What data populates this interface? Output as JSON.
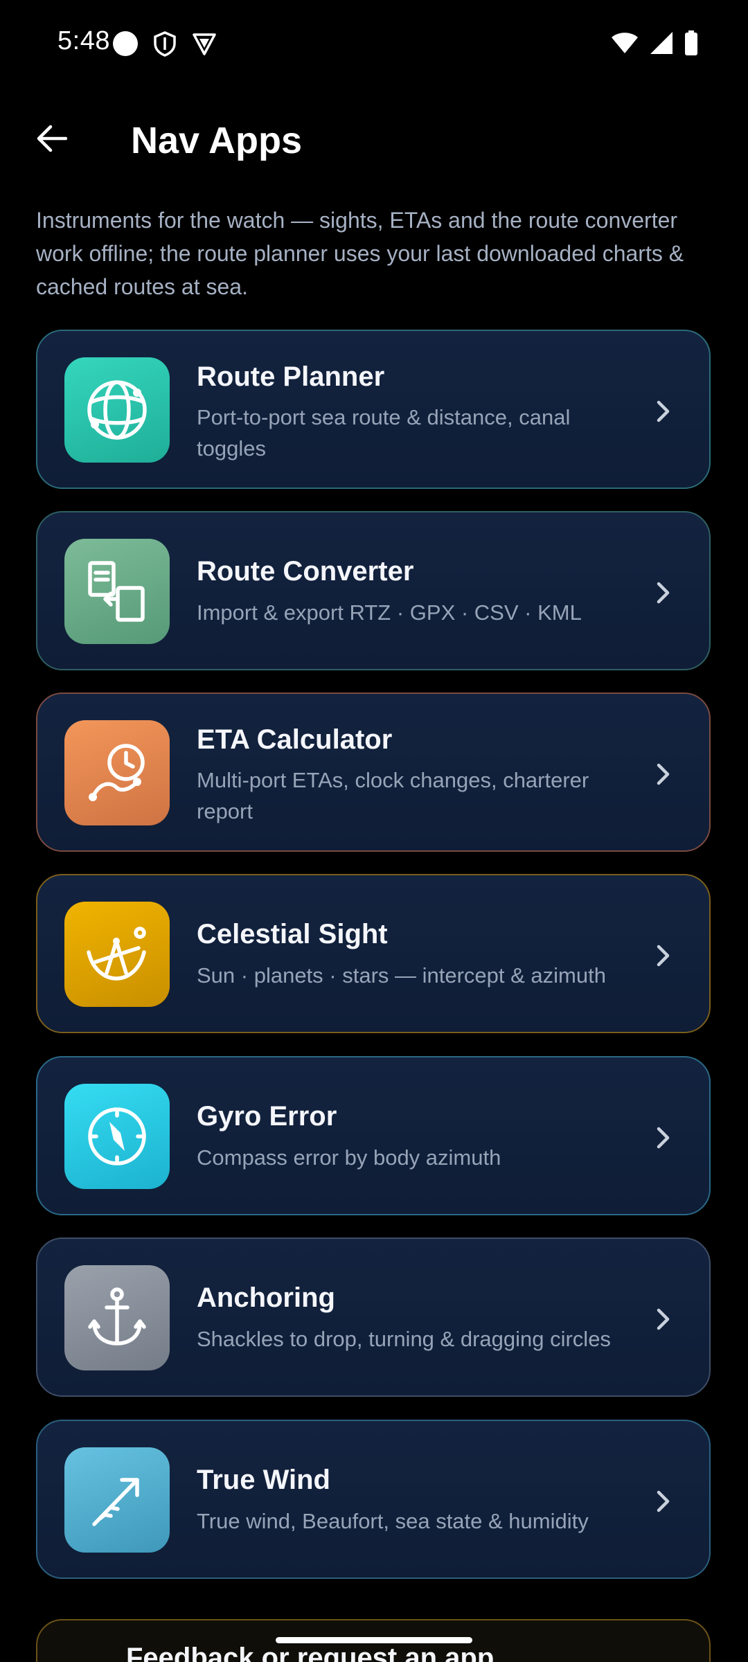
{
  "status_bar": {
    "time": "5:48"
  },
  "header": {
    "title": "Nav Apps",
    "back_icon": "arrow-left-icon"
  },
  "intro": "Instruments for the watch — sights, ETAs and the route converter work offline; the route planner uses your last downloaded charts & cached routes at sea.",
  "apps": [
    {
      "title": "Route Planner",
      "subtitle": "Port-to-port sea route & distance, canal toggles",
      "icon": "globe-icon",
      "accent": "#2ec9b0",
      "border": "#2a6a78"
    },
    {
      "title": "Route Converter",
      "subtitle": "Import & export RTZ · GPX · CSV · KML",
      "icon": "file-convert-icon",
      "accent": "#6cae8a",
      "border": "#2f5e62"
    },
    {
      "title": "ETA Calculator",
      "subtitle": "Multi-port ETAs, clock changes, charterer report",
      "icon": "clock-route-icon",
      "accent": "#e8864f",
      "border": "#7a4a40"
    },
    {
      "title": "Celestial Sight",
      "subtitle": "Sun · planets · stars — intercept & azimuth",
      "icon": "sextant-icon",
      "accent": "#e0a400",
      "border": "#7a5e1c"
    },
    {
      "title": "Gyro Error",
      "subtitle": "Compass error by body azimuth",
      "icon": "compass-icon",
      "accent": "#2dcfe8",
      "border": "#2a6886"
    },
    {
      "title": "Anchoring",
      "subtitle": "Shackles to drop, turning & dragging circles",
      "icon": "anchor-icon",
      "accent": "#8a929e",
      "border": "#3e4d66"
    },
    {
      "title": "True Wind",
      "subtitle": "True wind, Beaufort, sea state & humidity",
      "icon": "wind-arrow-icon",
      "accent": "#55b4d6",
      "border": "#2a5f7e"
    }
  ],
  "feedback": {
    "label": "Feedback or request an app"
  },
  "colors": {
    "background": "#000000",
    "card": "#13233f",
    "text_secondary": "#97a4b8"
  }
}
